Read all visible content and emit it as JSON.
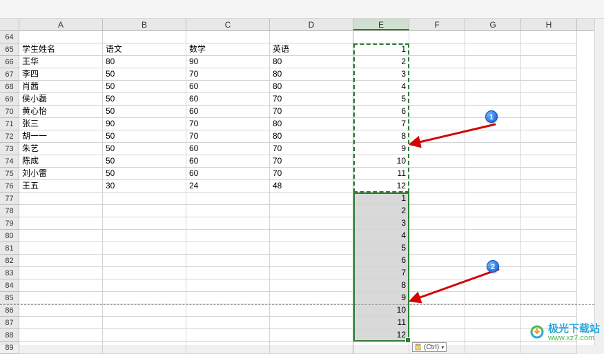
{
  "colLabels": [
    "A",
    "B",
    "C",
    "D",
    "E",
    "F",
    "G",
    "H"
  ],
  "rowStart": 64,
  "rowEnd": 89,
  "headers": {
    "a": "学生姓名",
    "b": "语文",
    "c": "数学",
    "d": "英语"
  },
  "data": [
    {
      "a": "王华",
      "b": "80",
      "c": "90",
      "d": "80",
      "e": "2"
    },
    {
      "a": "李四",
      "b": "50",
      "c": "70",
      "d": "80",
      "e": "3"
    },
    {
      "a": "肖茜",
      "b": "50",
      "c": "60",
      "d": "80",
      "e": "4"
    },
    {
      "a": "侯小磊",
      "b": "50",
      "c": "60",
      "d": "70",
      "e": "5"
    },
    {
      "a": "黄心怡",
      "b": "50",
      "c": "60",
      "d": "70",
      "e": "6"
    },
    {
      "a": "张三",
      "b": "90",
      "c": "70",
      "d": "80",
      "e": "7"
    },
    {
      "a": "胡一一",
      "b": "50",
      "c": "70",
      "d": "80",
      "e": "8"
    },
    {
      "a": "朱艺",
      "b": "50",
      "c": "60",
      "d": "70",
      "e": "9"
    },
    {
      "a": "陈成",
      "b": "50",
      "c": "60",
      "d": "70",
      "e": "10"
    },
    {
      "a": "刘小雷",
      "b": "50",
      "c": "60",
      "d": "70",
      "e": "11"
    },
    {
      "a": "王五",
      "b": "30",
      "c": "24",
      "d": "48",
      "e": "12"
    }
  ],
  "headerE": "1",
  "pasteValues": [
    "1",
    "2",
    "3",
    "4",
    "5",
    "6",
    "7",
    "8",
    "9",
    "10",
    "11",
    "12"
  ],
  "badges": {
    "b1": "1",
    "b2": "2"
  },
  "pasteBtn": {
    "label": "(Ctrl)",
    "arrow": "▾"
  },
  "watermark": {
    "brand": "极光下载站",
    "url": "www.xz7.com"
  }
}
